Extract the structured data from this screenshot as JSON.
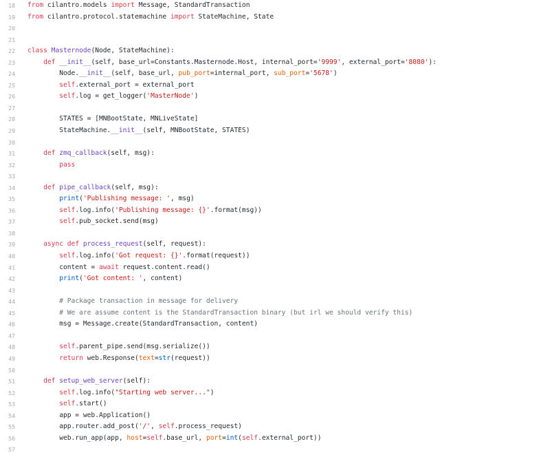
{
  "editor": {
    "colors": {
      "keyword": "#d73a49",
      "string": "#c41a16",
      "function": "#6f42c1",
      "comment": "#6a737d",
      "line_number": "#a3a9b0",
      "text": "#24292e"
    },
    "lines": [
      {
        "n": "18",
        "tokens": [
          {
            "t": "kw",
            "v": "from"
          },
          {
            "t": "plain",
            "v": " cilantro.models "
          },
          {
            "t": "kw",
            "v": "import"
          },
          {
            "t": "plain",
            "v": " Message, StandardTransaction"
          }
        ]
      },
      {
        "n": "19",
        "tokens": [
          {
            "t": "kw",
            "v": "from"
          },
          {
            "t": "plain",
            "v": " cilantro.protocol.statemachine "
          },
          {
            "t": "kw",
            "v": "import"
          },
          {
            "t": "plain",
            "v": " StateMachine, State"
          }
        ]
      },
      {
        "n": "20",
        "tokens": []
      },
      {
        "n": "21",
        "tokens": []
      },
      {
        "n": "22",
        "tokens": [
          {
            "t": "kw",
            "v": "class"
          },
          {
            "t": "plain",
            "v": " "
          },
          {
            "t": "fn",
            "v": "Masternode"
          },
          {
            "t": "plain",
            "v": "(Node, StateMachine):"
          }
        ]
      },
      {
        "n": "23",
        "tokens": [
          {
            "t": "plain",
            "v": "    "
          },
          {
            "t": "kw",
            "v": "def"
          },
          {
            "t": "plain",
            "v": " "
          },
          {
            "t": "fn",
            "v": "__init__"
          },
          {
            "t": "plain",
            "v": "(self, base_url=Constants.Masternode.Host, internal_port="
          },
          {
            "t": "str",
            "v": "'9999'"
          },
          {
            "t": "plain",
            "v": ", external_port="
          },
          {
            "t": "str",
            "v": "'8080'"
          },
          {
            "t": "plain",
            "v": "):"
          }
        ]
      },
      {
        "n": "24",
        "tokens": [
          {
            "t": "plain",
            "v": "        Node."
          },
          {
            "t": "fn",
            "v": "__init__"
          },
          {
            "t": "plain",
            "v": "(self, base_url, "
          },
          {
            "t": "attr",
            "v": "pub_port"
          },
          {
            "t": "plain",
            "v": "=internal_port, "
          },
          {
            "t": "attr",
            "v": "sub_port"
          },
          {
            "t": "plain",
            "v": "="
          },
          {
            "t": "str",
            "v": "'5678'"
          },
          {
            "t": "plain",
            "v": ")"
          }
        ]
      },
      {
        "n": "25",
        "tokens": [
          {
            "t": "plain",
            "v": "        "
          },
          {
            "t": "self",
            "v": "self"
          },
          {
            "t": "plain",
            "v": ".external_port = external_port"
          }
        ]
      },
      {
        "n": "26",
        "tokens": [
          {
            "t": "plain",
            "v": "        "
          },
          {
            "t": "self",
            "v": "self"
          },
          {
            "t": "plain",
            "v": ".log = get_logger("
          },
          {
            "t": "str",
            "v": "'MasterNode'"
          },
          {
            "t": "plain",
            "v": ")"
          }
        ]
      },
      {
        "n": "27",
        "tokens": []
      },
      {
        "n": "28",
        "tokens": [
          {
            "t": "plain",
            "v": "        STATES = [MNBootState, MNLiveState]"
          }
        ]
      },
      {
        "n": "29",
        "tokens": [
          {
            "t": "plain",
            "v": "        StateMachine."
          },
          {
            "t": "fn",
            "v": "__init__"
          },
          {
            "t": "plain",
            "v": "(self, MNBootState, STATES)"
          }
        ]
      },
      {
        "n": "30",
        "tokens": []
      },
      {
        "n": "31",
        "tokens": [
          {
            "t": "plain",
            "v": "    "
          },
          {
            "t": "kw",
            "v": "def"
          },
          {
            "t": "plain",
            "v": " "
          },
          {
            "t": "fn",
            "v": "zmq_callback"
          },
          {
            "t": "plain",
            "v": "(self, msg):"
          }
        ]
      },
      {
        "n": "32",
        "tokens": [
          {
            "t": "plain",
            "v": "        "
          },
          {
            "t": "kw",
            "v": "pass"
          }
        ]
      },
      {
        "n": "33",
        "tokens": []
      },
      {
        "n": "34",
        "tokens": [
          {
            "t": "plain",
            "v": "    "
          },
          {
            "t": "kw",
            "v": "def"
          },
          {
            "t": "plain",
            "v": " "
          },
          {
            "t": "fn",
            "v": "pipe_callback"
          },
          {
            "t": "plain",
            "v": "(self, msg):"
          }
        ]
      },
      {
        "n": "35",
        "tokens": [
          {
            "t": "plain",
            "v": "        "
          },
          {
            "t": "builtin",
            "v": "print"
          },
          {
            "t": "plain",
            "v": "("
          },
          {
            "t": "str",
            "v": "'Publishing message: '"
          },
          {
            "t": "plain",
            "v": ", msg)"
          }
        ]
      },
      {
        "n": "36",
        "tokens": [
          {
            "t": "plain",
            "v": "        "
          },
          {
            "t": "self",
            "v": "self"
          },
          {
            "t": "plain",
            "v": ".log.info("
          },
          {
            "t": "str",
            "v": "'Publishing message: {}'"
          },
          {
            "t": "plain",
            "v": ".format(msg))"
          }
        ]
      },
      {
        "n": "37",
        "tokens": [
          {
            "t": "plain",
            "v": "        "
          },
          {
            "t": "self",
            "v": "self"
          },
          {
            "t": "plain",
            "v": ".pub_socket.send(msg)"
          }
        ]
      },
      {
        "n": "38",
        "tokens": []
      },
      {
        "n": "39",
        "tokens": [
          {
            "t": "plain",
            "v": "    "
          },
          {
            "t": "kw",
            "v": "async"
          },
          {
            "t": "plain",
            "v": " "
          },
          {
            "t": "kw",
            "v": "def"
          },
          {
            "t": "plain",
            "v": " "
          },
          {
            "t": "fn",
            "v": "process_request"
          },
          {
            "t": "plain",
            "v": "(self, request):"
          }
        ]
      },
      {
        "n": "40",
        "tokens": [
          {
            "t": "plain",
            "v": "        "
          },
          {
            "t": "self",
            "v": "self"
          },
          {
            "t": "plain",
            "v": ".log.info("
          },
          {
            "t": "str",
            "v": "'Got request: {}'"
          },
          {
            "t": "plain",
            "v": ".format(request))"
          }
        ]
      },
      {
        "n": "41",
        "tokens": [
          {
            "t": "plain",
            "v": "        content = "
          },
          {
            "t": "kw",
            "v": "await"
          },
          {
            "t": "plain",
            "v": " request.content.read()"
          }
        ]
      },
      {
        "n": "42",
        "tokens": [
          {
            "t": "plain",
            "v": "        "
          },
          {
            "t": "builtin",
            "v": "print"
          },
          {
            "t": "plain",
            "v": "("
          },
          {
            "t": "str",
            "v": "'Got content: '"
          },
          {
            "t": "plain",
            "v": ", content)"
          }
        ]
      },
      {
        "n": "43",
        "tokens": []
      },
      {
        "n": "44",
        "tokens": [
          {
            "t": "plain",
            "v": "        "
          },
          {
            "t": "cm",
            "v": "# Package transaction in message for delivery"
          }
        ]
      },
      {
        "n": "45",
        "tokens": [
          {
            "t": "plain",
            "v": "        "
          },
          {
            "t": "cm",
            "v": "# We are assume content is the StandardTransaction binary (but irl we should verify this)"
          }
        ]
      },
      {
        "n": "46",
        "tokens": [
          {
            "t": "plain",
            "v": "        msg = Message.create(StandardTransaction, content)"
          }
        ]
      },
      {
        "n": "47",
        "tokens": []
      },
      {
        "n": "48",
        "tokens": [
          {
            "t": "plain",
            "v": "        "
          },
          {
            "t": "self",
            "v": "self"
          },
          {
            "t": "plain",
            "v": ".parent_pipe.send(msg.serialize())"
          }
        ]
      },
      {
        "n": "49",
        "tokens": [
          {
            "t": "plain",
            "v": "        "
          },
          {
            "t": "kw",
            "v": "return"
          },
          {
            "t": "plain",
            "v": " web.Response("
          },
          {
            "t": "attr",
            "v": "text"
          },
          {
            "t": "plain",
            "v": "="
          },
          {
            "t": "builtin",
            "v": "str"
          },
          {
            "t": "plain",
            "v": "(request))"
          }
        ]
      },
      {
        "n": "50",
        "tokens": []
      },
      {
        "n": "51",
        "tokens": [
          {
            "t": "plain",
            "v": "    "
          },
          {
            "t": "kw",
            "v": "def"
          },
          {
            "t": "plain",
            "v": " "
          },
          {
            "t": "fn",
            "v": "setup_web_server"
          },
          {
            "t": "plain",
            "v": "(self):"
          }
        ]
      },
      {
        "n": "52",
        "tokens": [
          {
            "t": "plain",
            "v": "        "
          },
          {
            "t": "self",
            "v": "self"
          },
          {
            "t": "plain",
            "v": ".log.info("
          },
          {
            "t": "str",
            "v": "\"Starting web server...\""
          },
          {
            "t": "plain",
            "v": ")"
          }
        ]
      },
      {
        "n": "53",
        "tokens": [
          {
            "t": "plain",
            "v": "        "
          },
          {
            "t": "self",
            "v": "self"
          },
          {
            "t": "plain",
            "v": ".start()"
          }
        ]
      },
      {
        "n": "54",
        "tokens": [
          {
            "t": "plain",
            "v": "        app = web.Application()"
          }
        ]
      },
      {
        "n": "55",
        "tokens": [
          {
            "t": "plain",
            "v": "        app.router.add_post("
          },
          {
            "t": "str",
            "v": "'/'"
          },
          {
            "t": "plain",
            "v": ", "
          },
          {
            "t": "self",
            "v": "self"
          },
          {
            "t": "plain",
            "v": ".process_request)"
          }
        ]
      },
      {
        "n": "56",
        "tokens": [
          {
            "t": "plain",
            "v": "        web.run_app(app, "
          },
          {
            "t": "attr",
            "v": "host"
          },
          {
            "t": "plain",
            "v": "="
          },
          {
            "t": "self",
            "v": "self"
          },
          {
            "t": "plain",
            "v": ".base_url, "
          },
          {
            "t": "attr",
            "v": "port"
          },
          {
            "t": "plain",
            "v": "="
          },
          {
            "t": "builtin",
            "v": "int"
          },
          {
            "t": "plain",
            "v": "("
          },
          {
            "t": "self",
            "v": "self"
          },
          {
            "t": "plain",
            "v": ".external_port))"
          }
        ]
      },
      {
        "n": "57",
        "tokens": []
      }
    ]
  }
}
